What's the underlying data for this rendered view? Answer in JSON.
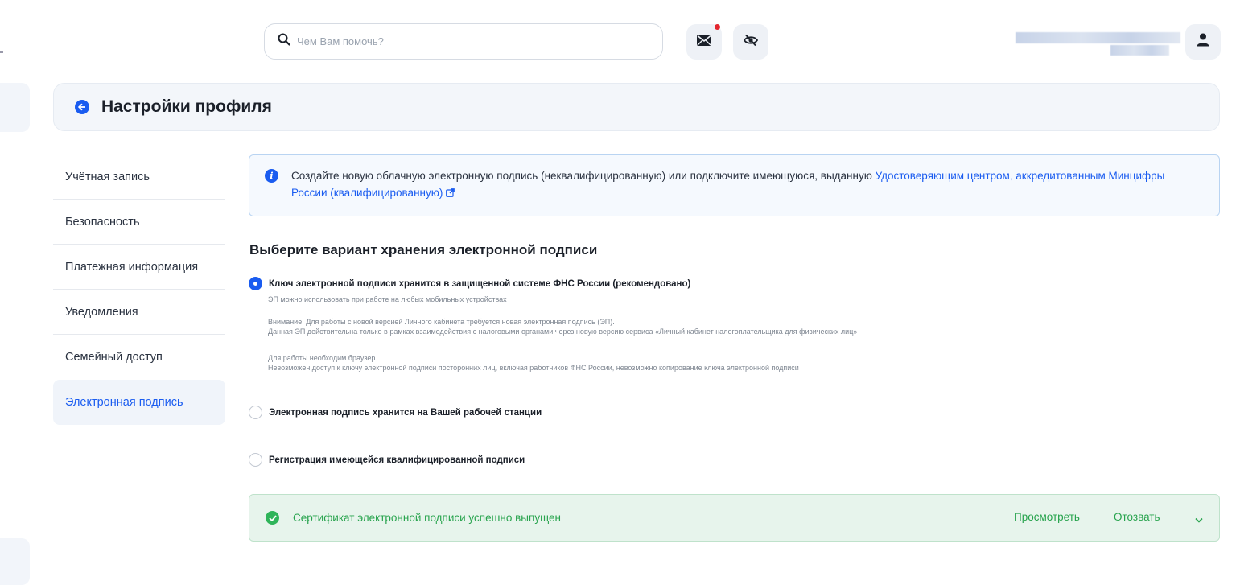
{
  "search": {
    "placeholder": "Чем Вам помочь?"
  },
  "header": {
    "title": "Настройки профиля"
  },
  "sidebar": {
    "items": [
      {
        "label": "Учётная запись"
      },
      {
        "label": "Безопасность"
      },
      {
        "label": "Платежная информация"
      },
      {
        "label": "Уведомления"
      },
      {
        "label": "Семейный доступ"
      },
      {
        "label": "Электронная подпись"
      }
    ]
  },
  "info": {
    "text": "Создайте новую облачную электронную подпись (неквалифицированную) или подключите имеющуюся, выданную ",
    "link": "Удостоверяющим центром, аккредитованным Минцифры России (квалифицированную)"
  },
  "main": {
    "section_title": "Выберите вариант хранения электронной подписи",
    "options": [
      {
        "label": "Ключ электронной подписи хранится в защищенной системе ФНС России (рекомендовано)",
        "selected": true
      },
      {
        "label": "Электронная подпись хранится на Вашей рабочей станции",
        "selected": false
      },
      {
        "label": "Регистрация имеющейся квалифицированной подписи",
        "selected": false
      }
    ],
    "option1_desc": {
      "line1": "ЭП можно использовать при работе на любых мобильных устройствах",
      "line2": "Внимание! Для работы с новой версией Личного кабинета требуется новая электронная подпись (ЭП).",
      "line3": "Данная ЭП действительна только в рамках взаимодействия с налоговыми органами через новую версию сервиса «Личный кабинет налогоплательщика для физических лиц»",
      "line4": "Для работы необходим браузер.",
      "line5": "Невозможен доступ к ключу электронной подписи посторонних лиц, включая работников ФНС России, невозможно копирование ключа электронной подписи"
    }
  },
  "certificate": {
    "status": "Сертификат электронной подписи успешно выпущен",
    "view_label": "Просмотреть",
    "revoke_label": "Отозвать"
  },
  "colors": {
    "accent": "#1a5cf0",
    "success": "#27a34d",
    "notification": "#e3262e"
  }
}
